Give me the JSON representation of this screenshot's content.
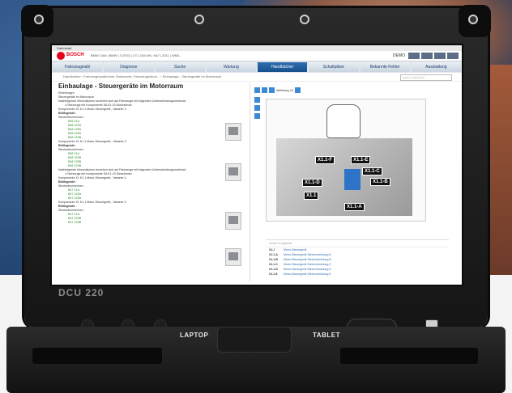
{
  "app": {
    "window_title": "Datenstatt",
    "brand": "BOSCH",
    "vehicle_info": "BMW 118d | BMW | 3 (F20) | 2.0 | 105 kW | N47 | 2011 | WBA...",
    "user_label": "DEMO"
  },
  "tabs": [
    {
      "label": "Fahrzeugwahl",
      "icon": "car-icon"
    },
    {
      "label": "Diagnose",
      "icon": "diagnose-icon"
    },
    {
      "label": "Suche",
      "icon": "search-icon"
    },
    {
      "label": "Wartung",
      "icon": "wrench-icon"
    },
    {
      "label": "Handbücher",
      "icon": "book-icon",
      "active": true
    },
    {
      "label": "Schaltpläne",
      "icon": "circuit-icon"
    },
    {
      "label": "Bekannte Fehler",
      "icon": "warning-icon"
    },
    {
      "label": "Ausstattung",
      "icon": "equipment-icon"
    }
  ],
  "breadcrumb": "Handbücher › Fahrzeughandbücher, Einbauorte, Fahrzeugdokum... › Einbaulage - Steuergeräte im Motorraum",
  "search_placeholder": "Suche im Dokument",
  "left": {
    "title": "Einbaulage - Steuergeräte im Motorraum",
    "lines": [
      {
        "t": "Einleitungen",
        "c": ""
      },
      {
        "t": "Steuergeräte im Motorraum",
        "c": ""
      },
      {
        "t": "Nachfolgende Informationen beziehen sich auf Fahrzeuge mit folgenden Unterscheidungsmerkmal:",
        "c": ""
      },
      {
        "t": "• Fahrzeuge mit Komponente  SA  K1.15 Motorsteuer",
        "c": "ind"
      },
      {
        "t": "Komponente  X1  K1.1 Motor-Steuergerät , Variante 1:",
        "c": ""
      },
      {
        "t": "Bildlegende:",
        "c": "b"
      },
      {
        "t": "Steckerbezeichnen:",
        "c": ""
      },
      {
        "t": "B36 X1A",
        "c": "ind2"
      },
      {
        "t": "B48 X20A",
        "c": "ind2"
      },
      {
        "t": "B48 X25A",
        "c": "ind2"
      },
      {
        "t": "B46 X20A",
        "c": "ind2"
      },
      {
        "t": "B46 X20B",
        "c": "ind2"
      },
      {
        "t": "Komponente  X1  K1.1 Motor-Steuergerät , Variante 2:",
        "c": ""
      },
      {
        "t": "Bildlegende:",
        "c": "b"
      },
      {
        "t": "Steckerbezeichnen:",
        "c": ""
      },
      {
        "t": "B38 X1A",
        "c": "ind2"
      },
      {
        "t": "B48 X20B",
        "c": "ind2"
      },
      {
        "t": "B48 X25B",
        "c": "ind2"
      },
      {
        "t": "B46 X20B",
        "c": "ind2"
      },
      {
        "t": "Nachfolgende Informationen beziehen sich auf Fahrzeuge mit folgenden Unterscheidungsmerkmal:",
        "c": ""
      },
      {
        "t": "• Fahrzeuge mit Komponente  SA  K1.15 Dieselmotor",
        "c": "ind"
      },
      {
        "t": "Komponente  X1  K1.1 Motor-Steuergerät , Variante 1:",
        "c": ""
      },
      {
        "t": "Bildlegende:",
        "c": "b"
      },
      {
        "t": "Steckerbezeichnen:",
        "c": ""
      },
      {
        "t": "B47 X1A",
        "c": "ind2"
      },
      {
        "t": "B47 X20A",
        "c": "ind2"
      },
      {
        "t": "B47 X25A",
        "c": "ind2"
      },
      {
        "t": "Komponente  X1  K1.1 Motor-Steuergerät , Variante 2:",
        "c": ""
      },
      {
        "t": "Bildlegende:",
        "c": "b"
      },
      {
        "t": "Steckerbezeichnen:",
        "c": ""
      },
      {
        "t": "B47 X1A",
        "c": "ind2"
      },
      {
        "t": "B47 X20B",
        "c": "ind2"
      },
      {
        "t": "B47 X25B",
        "c": "ind2"
      }
    ]
  },
  "right": {
    "toolbar_label": "Abbildung 1/4",
    "diagram_tags": [
      "X1.1-F",
      "X1.1-E",
      "X1.1-C",
      "X1.1-B",
      "X1.1-D",
      "X1.1",
      "X1.1-A"
    ],
    "table_search_placeholder": "Suche in Legende",
    "rows": [
      {
        "code": "X1.1",
        "desc": "Motor-Steuergerät"
      },
      {
        "code": "X1.1-A",
        "desc": "Motor-Steuergerät Steckverbindung A"
      },
      {
        "code": "X1.1-B",
        "desc": "Motor-Steuergerät Steckverbindung B"
      },
      {
        "code": "X1.1-C",
        "desc": "Motor-Steuergerät Steckverbindung C"
      },
      {
        "code": "X1.1-D",
        "desc": "Motor-Steuergerät Steckverbindung D"
      },
      {
        "code": "X1.1-E",
        "desc": "Motor-Steuergerät Steckverbindung E"
      }
    ]
  },
  "device": {
    "model": "DCU 220",
    "laptop_label": "LAPTOP",
    "tablet_label": "TABLET"
  }
}
